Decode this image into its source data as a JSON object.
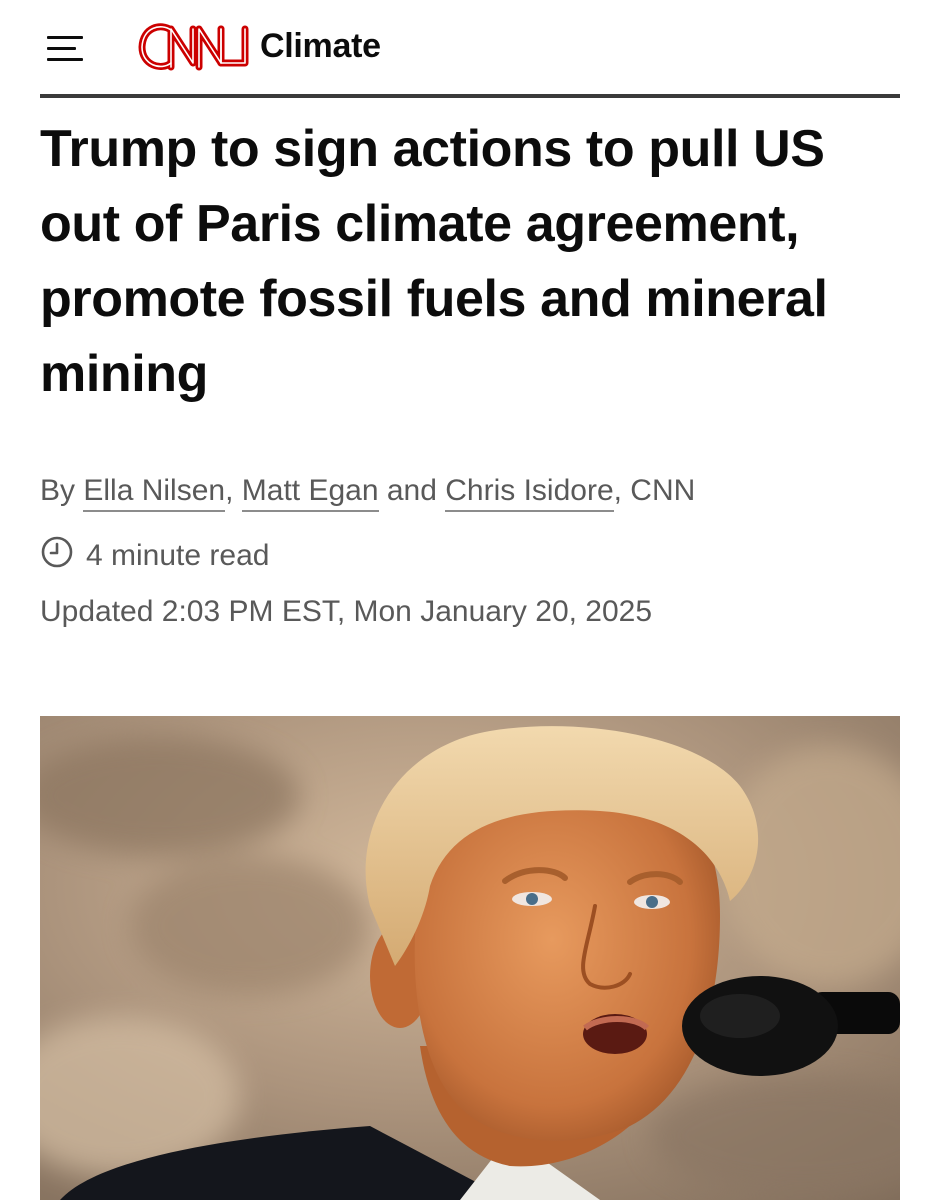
{
  "header": {
    "menu_icon": "hamburger-menu-icon",
    "logo": "CNN",
    "section": "Climate"
  },
  "article": {
    "headline": "Trump to sign actions to pull US out of Paris climate agreement, promote fossil fuels and mineral mining",
    "byline": {
      "prefix": "By ",
      "authors": [
        "Ella Nilsen",
        "Matt Egan",
        "Chris Isidore"
      ],
      "sep1": ", ",
      "sep2": " and ",
      "suffix": ", CNN"
    },
    "read_time": "4 minute read",
    "read_time_icon": "clock-icon",
    "updated": "Updated 2:03 PM EST, Mon January 20, 2025"
  },
  "colors": {
    "brand_red": "#cc0000",
    "text": "#0c0c0c",
    "meta_text": "#595959"
  }
}
